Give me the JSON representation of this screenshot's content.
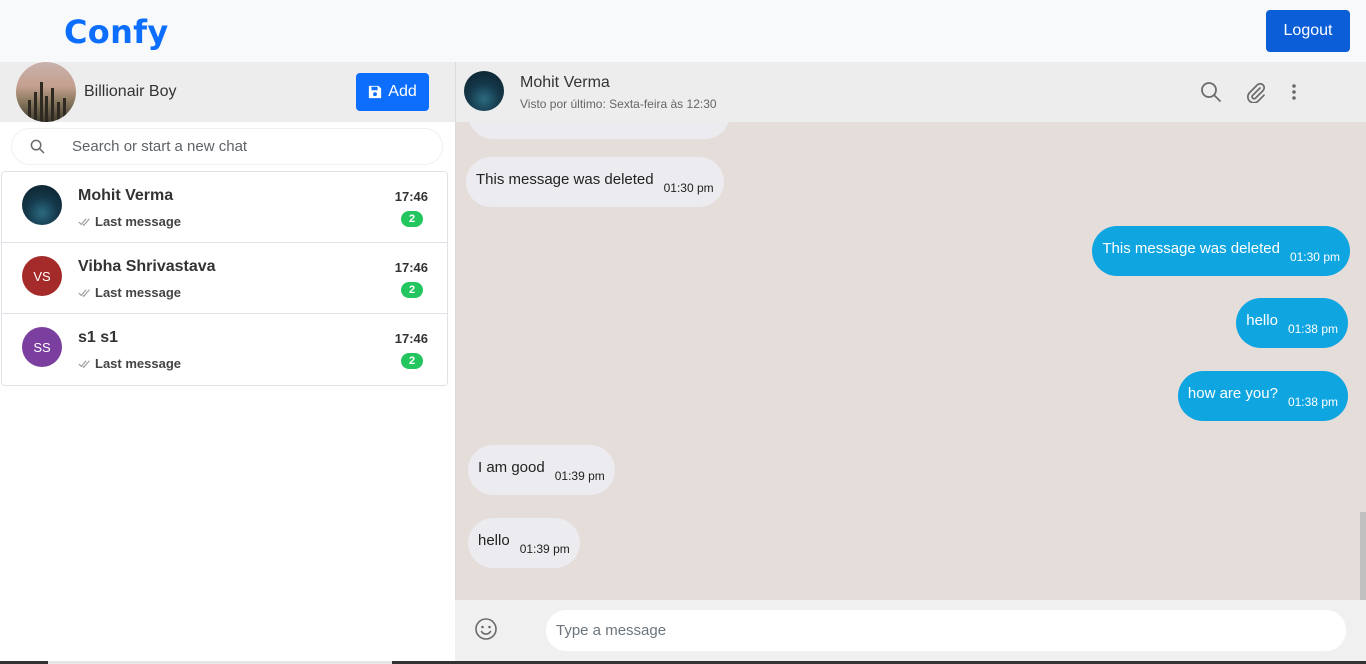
{
  "app": {
    "brand": "Confy",
    "logout_label": "Logout"
  },
  "profile": {
    "name": "Billionair Boy",
    "add_label": "Add"
  },
  "search": {
    "placeholder": "Search or start a new chat"
  },
  "chats": [
    {
      "name": "Mohit Verma",
      "initials": "",
      "last": "Last message",
      "time": "17:46",
      "unread": "2",
      "avatar_color": "#14384a"
    },
    {
      "name": "Vibha Shrivastava",
      "initials": "VS",
      "last": "Last message",
      "time": "17:46",
      "unread": "2",
      "avatar_color": "#a52a2a"
    },
    {
      "name": "s1 s1",
      "initials": "SS",
      "last": "Last message",
      "time": "17:46",
      "unread": "2",
      "avatar_color": "#7b3fa0"
    }
  ],
  "conversation": {
    "name": "Mohit Verma",
    "status": "Visto por último: Sexta-feira às 12:30",
    "messages": [
      {
        "direction": "in",
        "text": "This message was deleted",
        "time": "01:30 pm"
      },
      {
        "direction": "out",
        "text": "This message was deleted",
        "time": "01:30 pm"
      },
      {
        "direction": "out",
        "text": "hello",
        "time": "01:38 pm"
      },
      {
        "direction": "out",
        "text": "how are you?",
        "time": "01:38 pm"
      },
      {
        "direction": "in",
        "text": "I am good",
        "time": "01:39 pm"
      },
      {
        "direction": "in",
        "text": "hello",
        "time": "01:39 pm"
      }
    ]
  },
  "composer": {
    "placeholder": "Type a message"
  },
  "colors": {
    "brand": "#0d6efd",
    "logout": "#0b5ed7",
    "outgoing_bubble": "#0ea5e0",
    "incoming_bubble": "#ebebf0",
    "chat_background": "#e5ddd9",
    "unread_badge": "#22c55e"
  },
  "icons": {
    "header": [
      "search-icon",
      "paperclip-icon",
      "more-vertical-icon"
    ],
    "composer": "emoji-icon",
    "add_button": "save-icon"
  }
}
